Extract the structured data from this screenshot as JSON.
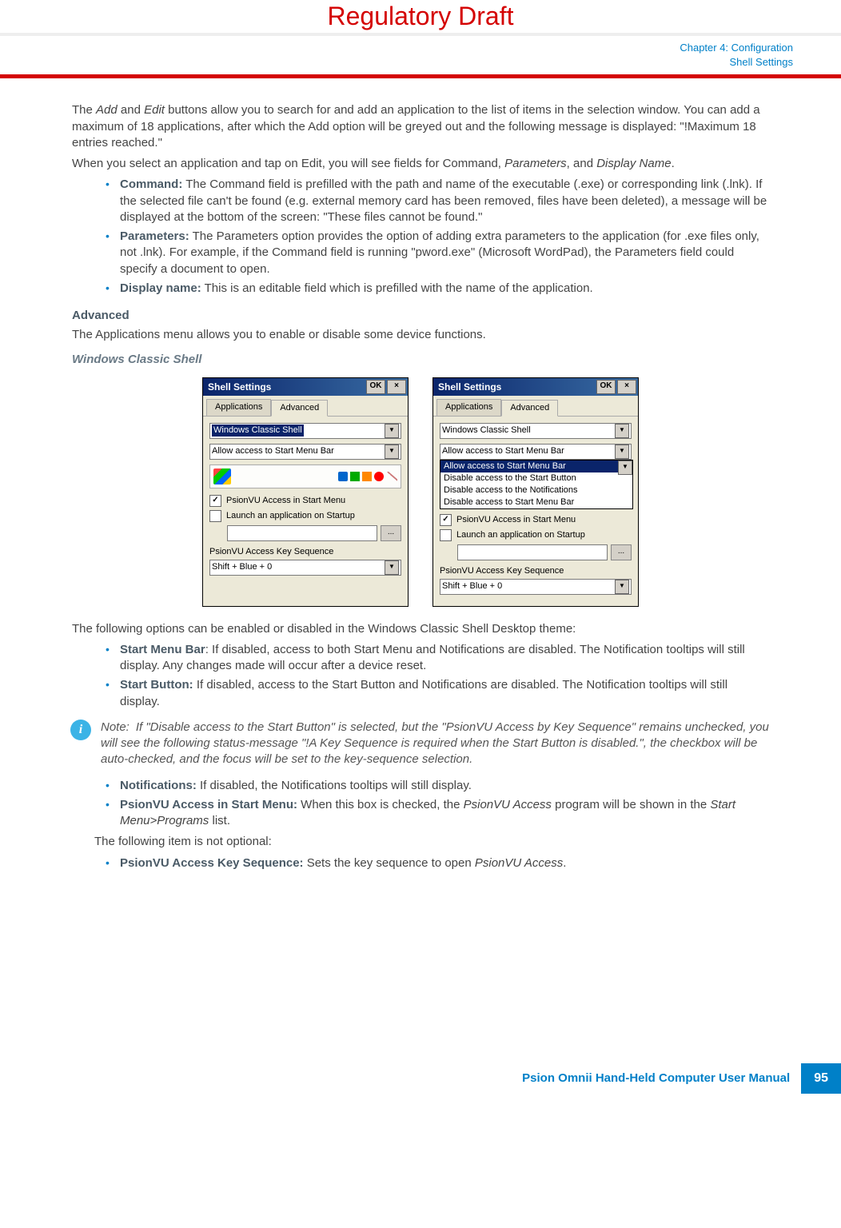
{
  "banner": "Regulatory Draft",
  "header": {
    "chapter": "Chapter 4:  Configuration",
    "section": "Shell Settings"
  },
  "para1_a": "The ",
  "para1_b": "Add",
  "para1_c": " and ",
  "para1_d": "Edit",
  "para1_e": " buttons allow you to search for and add an application to the list of items in the selection window. You can add a maximum of 18 applications, after which the Add option will be greyed out and the following message is displayed: \"!Maximum 18 entries reached.\"",
  "para2_a": "When you select an application and tap on Edit, you will see fields for Command, ",
  "para2_b": "Parameters",
  "para2_c": ", and ",
  "para2_d": "Display Name",
  "para2_e": ".",
  "bullets1": {
    "command_label": "Command:",
    "command_text": " The Command field is prefilled with the path and name of the executable (.exe) or corresponding link (.lnk). If the selected file can't be found (e.g. external memory card has been removed, files have been deleted), a message will be displayed at the bottom of the screen: \"These files cannot be found.\"",
    "params_label": "Parameters:",
    "params_text": " The Parameters option provides the option of adding extra parameters to the application (for .exe files only, not .lnk). For example, if the Command field is running \"pword.exe\" (Microsoft WordPad), the Parameters field could specify a document to open.",
    "display_label": "Display name:",
    "display_text": " This is an editable field which is prefilled with the name of the application."
  },
  "advanced_heading": "Advanced",
  "advanced_text": "The Applications menu allows you to enable or disable some device functions.",
  "wcs_heading": "Windows Classic Shell",
  "dialog": {
    "title": "Shell Settings",
    "ok": "OK",
    "close": "×",
    "tab1": "Applications",
    "tab2": "Advanced",
    "select1": "Windows Classic Shell",
    "select2": "Allow access to Start Menu Bar",
    "check1": "PsionVU Access in Start Menu",
    "check2": "Launch an application on Startup",
    "browse": "...",
    "label3": "PsionVU Access Key Sequence",
    "select3": "Shift + Blue + 0",
    "listbox": {
      "item1": "Allow access to Start Menu Bar",
      "item2": "Disable access to the Start Button",
      "item3": "Disable access to the Notifications",
      "item4": "Disable access to Start Menu Bar"
    }
  },
  "para3": "The following options can be enabled or disabled in the Windows Classic Shell Desktop theme:",
  "bullets2": {
    "smb_label": "Start Menu Bar",
    "smb_text": ": If disabled, access to both Start Menu and Notifications are disabled. The Notification tooltips will still display. Any changes made will occur after a device reset.",
    "sb_label": "Start Button:",
    "sb_text": " If disabled, access to the Start Button and Notifications are disabled. The Notification tooltips will still display."
  },
  "note_label": "Note:",
  "note_text": "If \"Disable access to the Start Button\" is selected, but the \"PsionVU Access by Key Sequence\" remains unchecked, you will see the following status-message \"!A Key Sequence is required when the Start Button is disabled.\", the checkbox will be auto-checked, and the focus will be set to the key-sequence selection.",
  "bullets3": {
    "notif_label": "Notifications:",
    "notif_text": " If disabled, the Notifications tooltips will still display.",
    "pva_label": "PsionVU Access in Start Menu:",
    "pva_text_a": " When this box is checked, the ",
    "pva_text_b": "PsionVU Access",
    "pva_text_c": " program will be shown in the ",
    "pva_text_d": "Start Menu>Programs",
    "pva_text_e": " list."
  },
  "para4": "The following item is not optional:",
  "bullets4": {
    "pvak_label": "PsionVU Access Key Sequence:",
    "pvak_text_a": " Sets the key sequence to open ",
    "pvak_text_b": "PsionVU Access",
    "pvak_text_c": "."
  },
  "footer": {
    "title": "Psion Omnii Hand-Held Computer User Manual",
    "page": "95"
  }
}
